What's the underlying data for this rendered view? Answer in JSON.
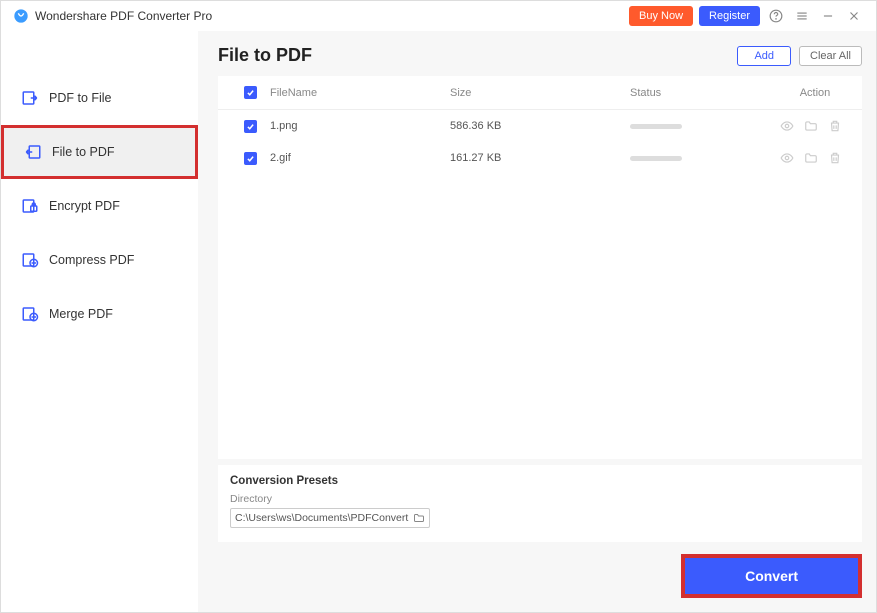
{
  "app": {
    "title": "Wondershare PDF Converter Pro"
  },
  "titlebar": {
    "buyNow": "Buy Now",
    "register": "Register"
  },
  "sidebar": {
    "items": [
      {
        "label": "PDF to File"
      },
      {
        "label": "File to PDF"
      },
      {
        "label": "Encrypt PDF"
      },
      {
        "label": "Compress PDF"
      },
      {
        "label": "Merge PDF"
      }
    ]
  },
  "main": {
    "title": "File to PDF",
    "add": "Add",
    "clearAll": "Clear All",
    "headers": {
      "filename": "FileName",
      "size": "Size",
      "status": "Status",
      "action": "Action"
    },
    "rows": [
      {
        "name": "1.png",
        "size": "586.36 KB"
      },
      {
        "name": "2.gif",
        "size": "161.27 KB"
      }
    ],
    "presetsTitle": "Conversion Presets",
    "directoryLabel": "Directory",
    "directoryValue": "C:\\Users\\ws\\Documents\\PDFConvert",
    "convert": "Convert"
  }
}
